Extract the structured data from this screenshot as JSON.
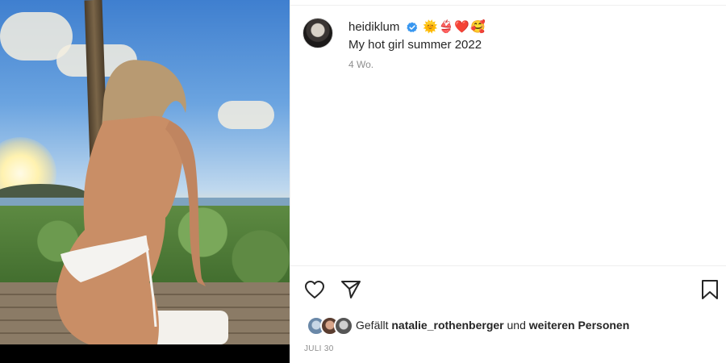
{
  "post": {
    "username": "heidiklum",
    "verified": true,
    "title_emojis": "🌞👙❤️🥰",
    "caption": "My hot girl summer 2022",
    "time_ago": "4 Wo.",
    "date": "JULI 30"
  },
  "likes": {
    "prefix": "Gefällt",
    "first_user": "natalie_rothenberger",
    "connector": "und",
    "others": "weiteren Personen"
  },
  "icons": {
    "like": "heart-outline-icon",
    "share": "paper-plane-icon",
    "save": "bookmark-outline-icon",
    "verified": "verified-badge-icon"
  },
  "colors": {
    "verified_blue": "#3897f0",
    "text": "#262626",
    "secondary_text": "#8e8e8e",
    "divider": "#efefef"
  }
}
